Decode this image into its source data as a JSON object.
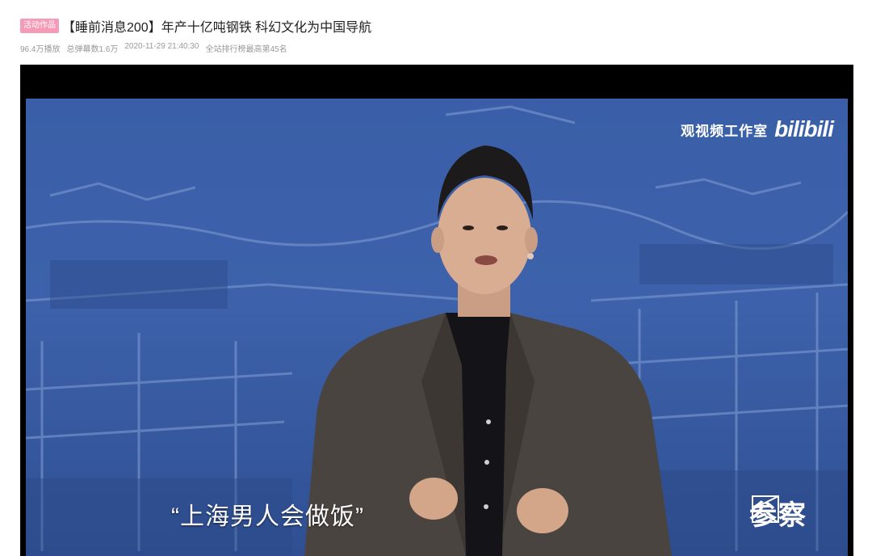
{
  "header": {
    "badge": "活动作品",
    "title": "【睡前消息200】年产十亿吨钢铁 科幻文化为中国导航",
    "meta": {
      "views": "96.4万播放",
      "danmaku": "总弹幕数1.6万",
      "datetime": "2020-11-29 21:40:30",
      "ranking": "全站排行榜最高第45名"
    }
  },
  "video": {
    "watermark_text": "观视频工作室",
    "watermark_logo": "bilibili",
    "subtitle": "“上海男人会做饭”",
    "corner_logo_text": "参察",
    "colors": {
      "background": "#3a5fa8",
      "jacket": "#4a4440",
      "shirt": "#141418",
      "badge": "#f59ab7"
    }
  }
}
